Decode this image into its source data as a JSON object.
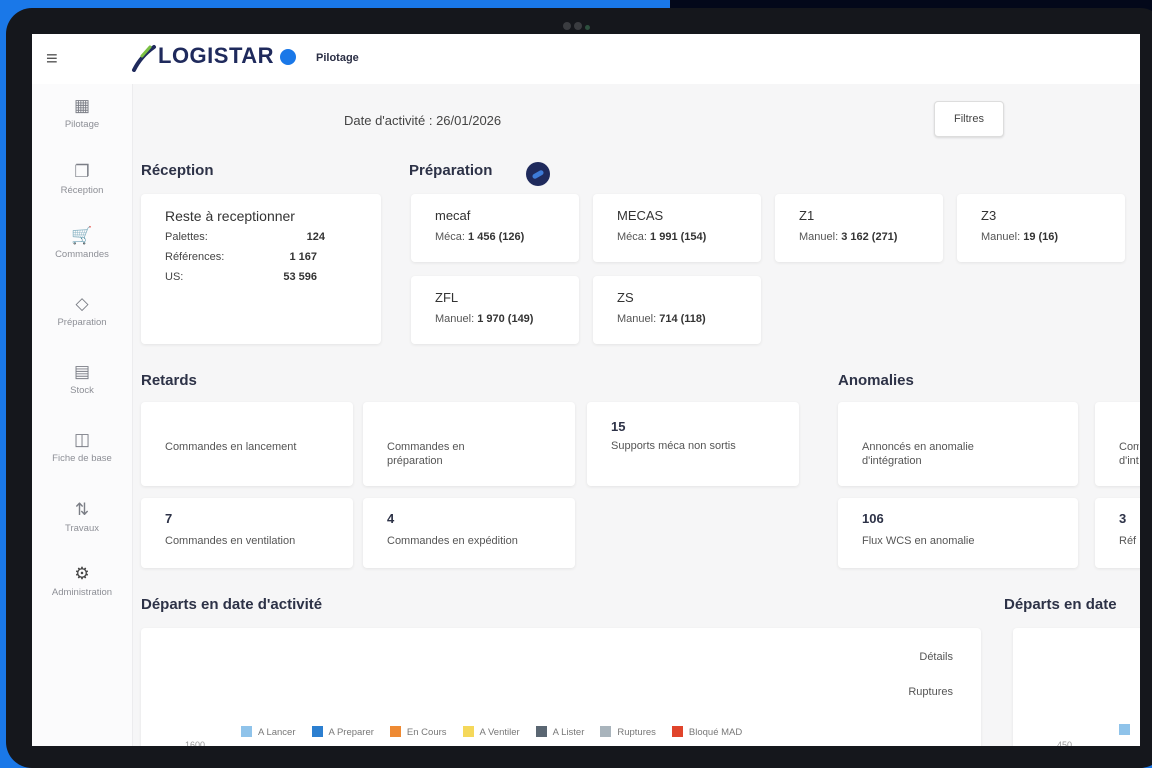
{
  "app": {
    "logo_text": "LOGISTAR",
    "module": "Pilotage"
  },
  "sidebar": {
    "items": [
      {
        "label": "Pilotage",
        "icon": "dashboard-icon"
      },
      {
        "label": "Réception",
        "icon": "package-icon"
      },
      {
        "label": "Commandes",
        "icon": "cart-icon"
      },
      {
        "label": "Préparation",
        "icon": "box-icon"
      },
      {
        "label": "Stock",
        "icon": "shelves-icon"
      },
      {
        "label": "Fiche de base",
        "icon": "book-icon"
      },
      {
        "label": "Travaux",
        "icon": "transfer-icon"
      },
      {
        "label": "Administration",
        "icon": "gear-icon"
      }
    ]
  },
  "header": {
    "date": "Date d'activité : 26/01/2026",
    "filters_label": "Filtres"
  },
  "reception": {
    "title": "Réception",
    "card_title": "Reste à receptionner",
    "rows": [
      {
        "label": "Palettes:",
        "value": "124"
      },
      {
        "label": "Références:",
        "value": "1 167"
      },
      {
        "label": "US:",
        "value": "53 596"
      }
    ]
  },
  "preparation": {
    "title": "Préparation",
    "cards": [
      {
        "name": "mecaf",
        "mode": "Méca:",
        "value": "1 456 (126)"
      },
      {
        "name": "MECAS",
        "mode": "Méca:",
        "value": "1 991 (154)"
      },
      {
        "name": "Z1",
        "mode": "Manuel:",
        "value": "3 162 (271)"
      },
      {
        "name": "Z3",
        "mode": "Manuel:",
        "value": "19 (16)"
      },
      {
        "name": "ZFL",
        "mode": "Manuel:",
        "value": "1 970 (149)"
      },
      {
        "name": "ZS",
        "mode": "Manuel:",
        "value": "714 (118)"
      }
    ]
  },
  "retards": {
    "title": "Retards",
    "cards": [
      {
        "value": "",
        "label": "Commandes en lancement"
      },
      {
        "value": "",
        "label": "Commandes en préparation"
      },
      {
        "value": "15",
        "label": "Supports méca non sortis"
      },
      {
        "value": "7",
        "label": "Commandes en ventilation"
      },
      {
        "value": "4",
        "label": "Commandes en expédition"
      }
    ]
  },
  "anomalies": {
    "title": "Anomalies",
    "cards": [
      {
        "value": "",
        "label": "Annoncés en anomalie d'intégration"
      },
      {
        "value": "",
        "label": "Com d'int"
      },
      {
        "value": "106",
        "label": "Flux WCS en anomalie"
      },
      {
        "value": "3",
        "label": "Réf"
      }
    ]
  },
  "departs": {
    "title": "Départs en date d'activité",
    "title2": "Départs en date",
    "details": "Détails",
    "ruptures": "Ruptures",
    "ytick": "1600",
    "ytick2": "450"
  },
  "chart_data": {
    "type": "bar",
    "title": "Départs en date d'activité",
    "series": [
      {
        "name": "A Lancer",
        "color": "#8fc3ea"
      },
      {
        "name": "A Preparer",
        "color": "#2c7fd0"
      },
      {
        "name": "En Cours",
        "color": "#ee8a33"
      },
      {
        "name": "A Ventiler",
        "color": "#f5d85a"
      },
      {
        "name": "A Lister",
        "color": "#5a6672"
      },
      {
        "name": "Ruptures",
        "color": "#a9b4bc"
      },
      {
        "name": "Bloqué MAD",
        "color": "#e0442b"
      }
    ],
    "yticks": [
      "1600"
    ]
  }
}
